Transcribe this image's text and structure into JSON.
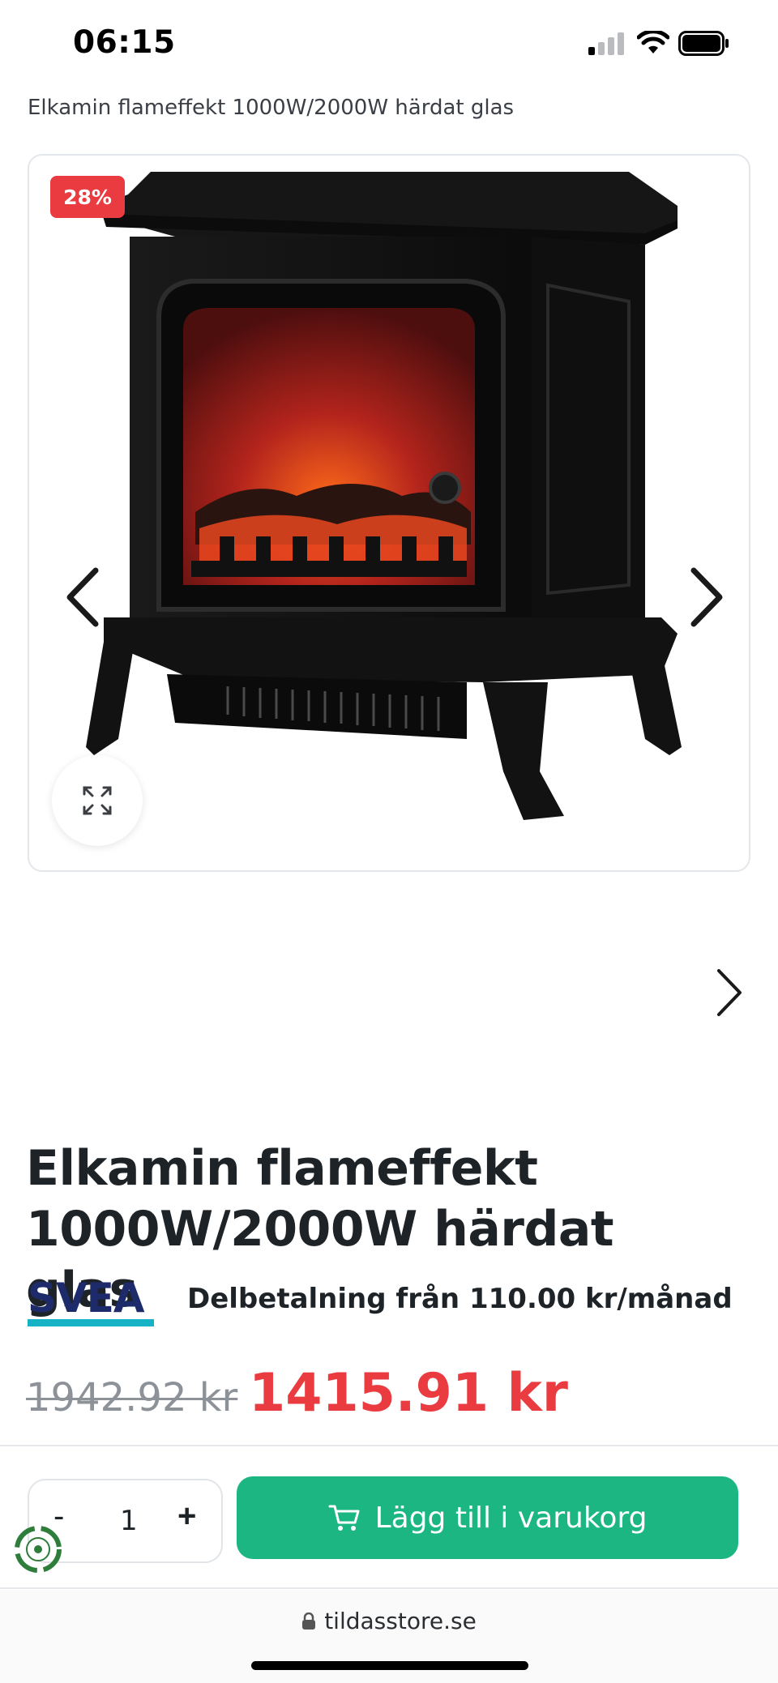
{
  "status_bar": {
    "time": "06:15"
  },
  "breadcrumb": {
    "text": "Elkamin flameffekt 1000W/2000W härdat glas"
  },
  "gallery": {
    "discount_badge": "28%"
  },
  "product": {
    "title": "Elkamin flameffekt 1000W/2000W härdat glas",
    "payment_logo": "SVEA",
    "installment_text": "Delbetalning från 110.00 kr/månad",
    "old_price": "1942.92 kr",
    "new_price": "1415.91 kr"
  },
  "buy_bar": {
    "qty_minus": "-",
    "quantity": "1",
    "qty_plus": "+",
    "add_to_cart": "Lägg till i varukorg"
  },
  "browser": {
    "url": "tildasstore.se"
  },
  "colors": {
    "discount": "#ea3b40",
    "price": "#ea3b40",
    "cta": "#1bb682",
    "svea_navy": "#1d2b6b",
    "svea_teal": "#16b3c7"
  },
  "icons": [
    "signal-icon",
    "wifi-icon",
    "battery-icon",
    "chevron-left-icon",
    "chevron-right-icon",
    "expand-icon",
    "cart-icon",
    "recycle-icon",
    "lock-icon"
  ]
}
